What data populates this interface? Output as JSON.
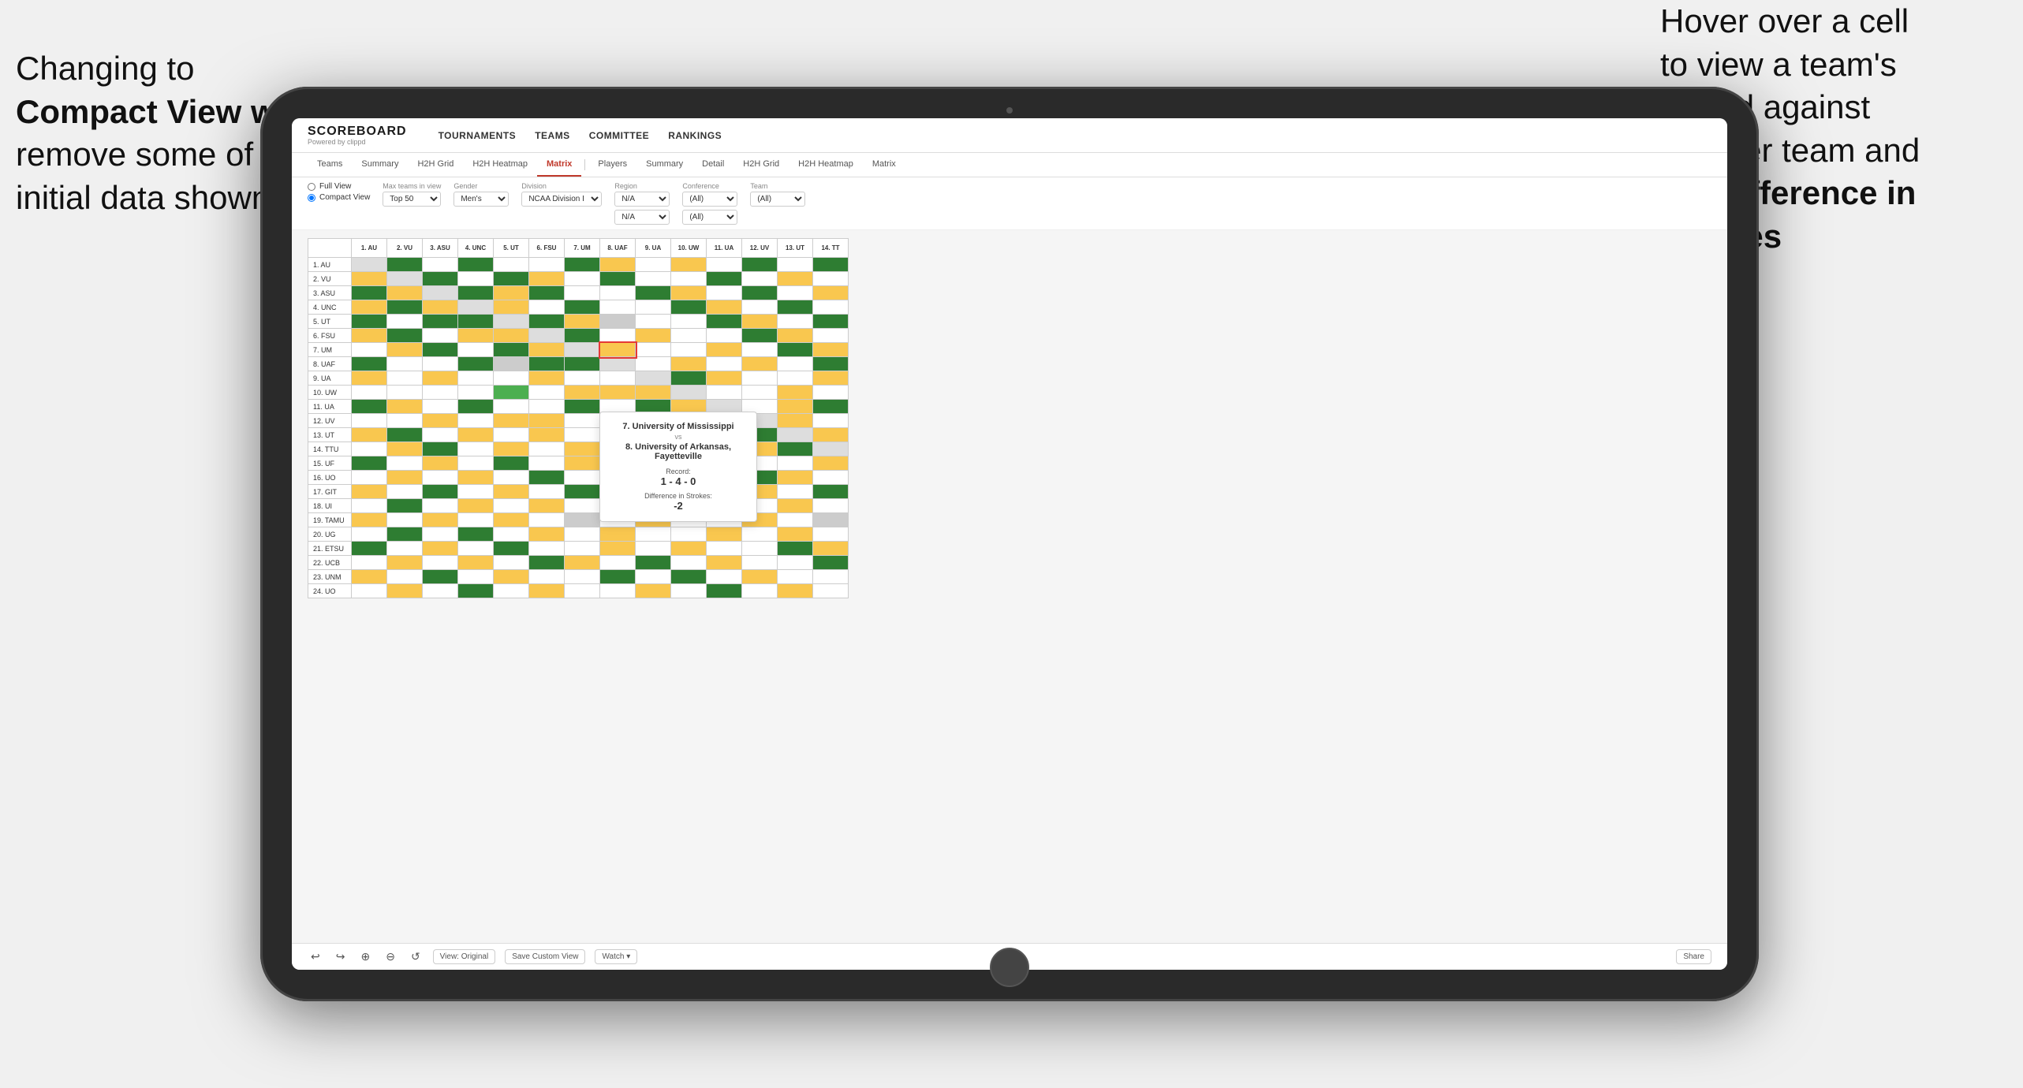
{
  "annotations": {
    "left": {
      "line1": "Changing to",
      "line2": "Compact View will",
      "line3": "remove some of the",
      "line4": "initial data shown"
    },
    "right": {
      "line1": "Hover over a cell",
      "line2": "to view a team's",
      "line3": "record against",
      "line4": "another team and",
      "line5": "the",
      "line6Bold": "Difference in Strokes"
    }
  },
  "scoreboard": {
    "logo": "SCOREBOARD",
    "logo_sub": "Powered by clippd",
    "nav": [
      "TOURNAMENTS",
      "TEAMS",
      "COMMITTEE",
      "RANKINGS"
    ]
  },
  "tabs": {
    "groups": [
      [
        "Teams",
        "Summary",
        "H2H Grid",
        "H2H Heatmap",
        "Matrix"
      ],
      [
        "Players",
        "Summary",
        "Detail",
        "H2H Grid",
        "H2H Heatmap",
        "Matrix"
      ]
    ],
    "active": "Matrix"
  },
  "controls": {
    "view_full": "Full View",
    "view_compact": "Compact View",
    "filter_max_teams": "Top 50",
    "filter_gender": "Men's",
    "filter_division": "NCAA Division I",
    "filter_region_label": "Region",
    "filter_region": "N/A",
    "filter_conference_label": "Conference",
    "filter_conference": "(All)",
    "filter_team_label": "Team",
    "filter_team": "(All)"
  },
  "column_headers": [
    "1. AU",
    "2. VU",
    "3. ASU",
    "4. UNC",
    "5. UT",
    "6. FSU",
    "7. UM",
    "8. UAF",
    "9. UA",
    "10. UW",
    "11. UA",
    "12. UV",
    "13. UT",
    "14. TT"
  ],
  "row_headers": [
    "1. AU",
    "2. VU",
    "3. ASU",
    "4. UNC",
    "5. UT",
    "6. FSU",
    "7. UM",
    "8. UAF",
    "9. UA",
    "10. UW",
    "11. UA",
    "12. UV",
    "13. UT",
    "14. TTU",
    "15. UF",
    "16. UO",
    "17. GIT",
    "18. UI",
    "19. TAMU",
    "20. UG",
    "21. ETSU",
    "22. UCB",
    "23. UNM",
    "24. UO"
  ],
  "tooltip": {
    "team1": "7. University of Mississippi",
    "vs": "vs",
    "team2": "8. University of Arkansas, Fayetteville",
    "record_label": "Record:",
    "record_value": "1 - 4 - 0",
    "diff_label": "Difference in Strokes:",
    "diff_value": "-2"
  },
  "toolbar": {
    "undo": "↩",
    "redo": "↪",
    "view_original": "View: Original",
    "save_custom": "Save Custom View",
    "watch": "Watch ▾",
    "share": "Share"
  }
}
